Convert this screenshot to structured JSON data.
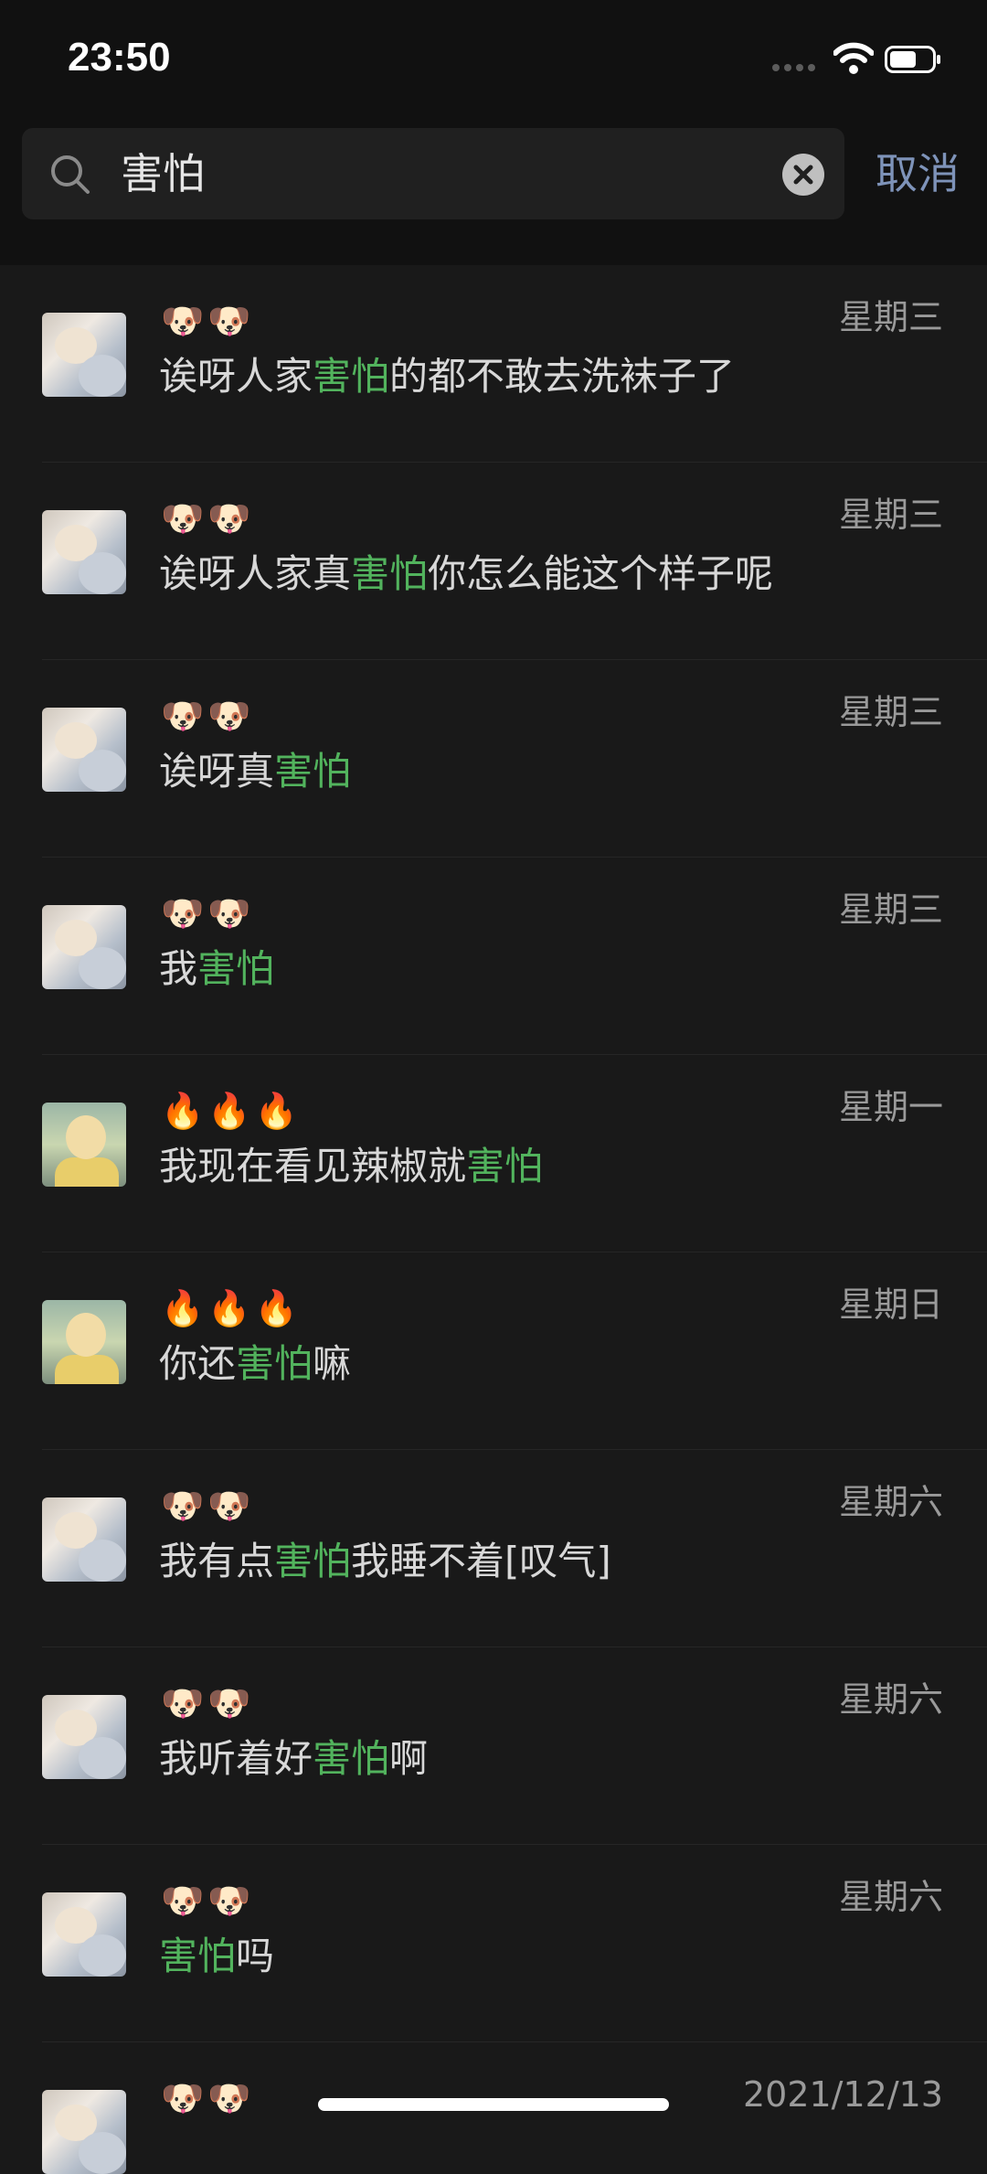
{
  "status_bar": {
    "time": "23:50"
  },
  "search": {
    "query": "害怕",
    "cancel_label": "取消"
  },
  "results": [
    {
      "sender": "🐶🐶",
      "avatar": "dog",
      "before": "诶呀人家",
      "match": "害怕",
      "after": "的都不敢去洗袜子了",
      "date": "星期三"
    },
    {
      "sender": "🐶🐶",
      "avatar": "dog",
      "before": "诶呀人家真",
      "match": "害怕",
      "after": "你怎么能这个样子呢",
      "date": "星期三"
    },
    {
      "sender": "🐶🐶",
      "avatar": "dog",
      "before": "诶呀真",
      "match": "害怕",
      "after": "",
      "date": "星期三"
    },
    {
      "sender": "🐶🐶",
      "avatar": "dog",
      "before": "我",
      "match": "害怕",
      "after": "",
      "date": "星期三"
    },
    {
      "sender": "🔥🔥🔥",
      "avatar": "cartoon",
      "before": "我现在看见辣椒就",
      "match": "害怕",
      "after": "",
      "date": "星期一"
    },
    {
      "sender": "🔥🔥🔥",
      "avatar": "cartoon",
      "before": "你还",
      "match": "害怕",
      "after": "嘛",
      "date": "星期日"
    },
    {
      "sender": "🐶🐶",
      "avatar": "dog",
      "before": "我有点",
      "match": "害怕",
      "after": "我睡不着[叹气]",
      "date": "星期六"
    },
    {
      "sender": "🐶🐶",
      "avatar": "dog",
      "before": "我听着好",
      "match": "害怕",
      "after": "啊",
      "date": "星期六"
    },
    {
      "sender": "🐶🐶",
      "avatar": "dog",
      "before": "",
      "match": "害怕",
      "after": "吗",
      "date": "星期六"
    },
    {
      "sender": "🐶🐶",
      "avatar": "dog",
      "before": "",
      "match": "",
      "after": "",
      "date": "2021/12/13"
    }
  ]
}
